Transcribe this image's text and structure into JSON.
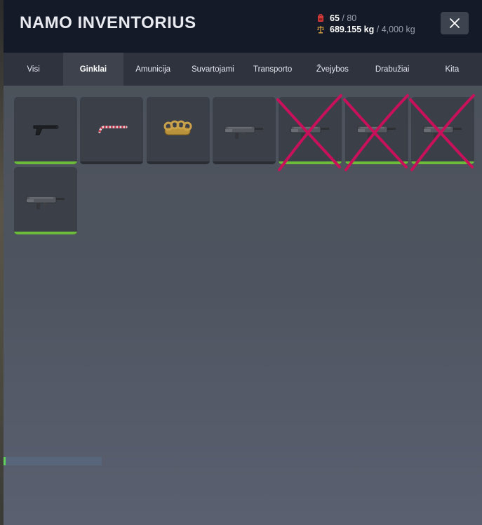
{
  "header": {
    "title": "NAMO INVENTORIUS",
    "slots_used": "65",
    "slots_max": "80",
    "weight_used": "689.155 kg",
    "weight_max": "4,000 kg",
    "separator": "/"
  },
  "tabs": [
    {
      "label": "Visi",
      "active": false
    },
    {
      "label": "Ginklai",
      "active": true
    },
    {
      "label": "Amunicija",
      "active": false
    },
    {
      "label": "Suvartojami",
      "active": false
    },
    {
      "label": "Transporto",
      "active": false
    },
    {
      "label": "Žvejybos",
      "active": false
    },
    {
      "label": "Drabužiai",
      "active": false
    },
    {
      "label": "Kita",
      "active": false
    }
  ],
  "items": [
    {
      "icon": "pistol-icon",
      "durability": 1.0
    },
    {
      "icon": "candy-cane-icon",
      "durability": 0.0
    },
    {
      "icon": "brass-knuckles-icon",
      "durability": 0.0
    },
    {
      "icon": "smg-icon",
      "durability": 0.0
    },
    {
      "icon": "smg-icon",
      "durability": 1.0,
      "crossed": true
    },
    {
      "icon": "smg-icon",
      "durability": 1.0,
      "crossed": true
    },
    {
      "icon": "smg-icon",
      "durability": 1.0,
      "crossed": true
    },
    {
      "icon": "smg-icon",
      "durability": 1.0
    }
  ],
  "colors": {
    "accent_green": "#6dbb3a",
    "cross_marker": "#c8115a",
    "header_bg": "#141a28"
  }
}
